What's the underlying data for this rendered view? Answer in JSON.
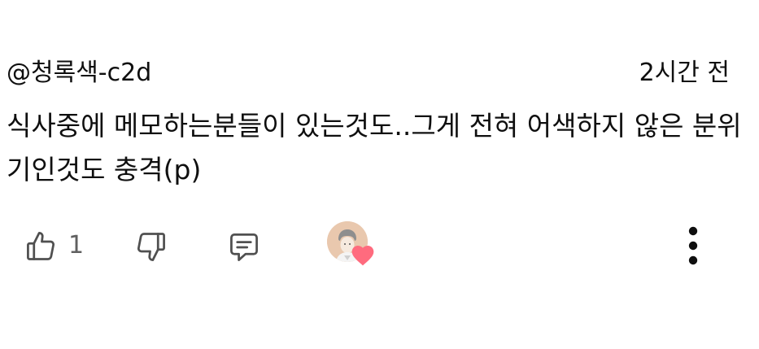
{
  "comment": {
    "author": "@청록색-c2d",
    "timestamp": "2시간 전",
    "text": "식사중에 메모하는분들이 있는것도..그게 전혀 어색하지 않은 분위기인것도 충격(p)",
    "like_count": "1"
  },
  "icons": {
    "like": "thumbs-up-icon",
    "dislike": "thumbs-down-icon",
    "reply": "comment-icon",
    "creator_heart": "heart-icon",
    "more": "more-vertical-icon"
  },
  "colors": {
    "text": "#0f0f0f",
    "secondary_text": "#606060",
    "icon_stroke": "#505050",
    "heart": "#ff6b7e",
    "avatar_bg": "#e9c8ae"
  }
}
